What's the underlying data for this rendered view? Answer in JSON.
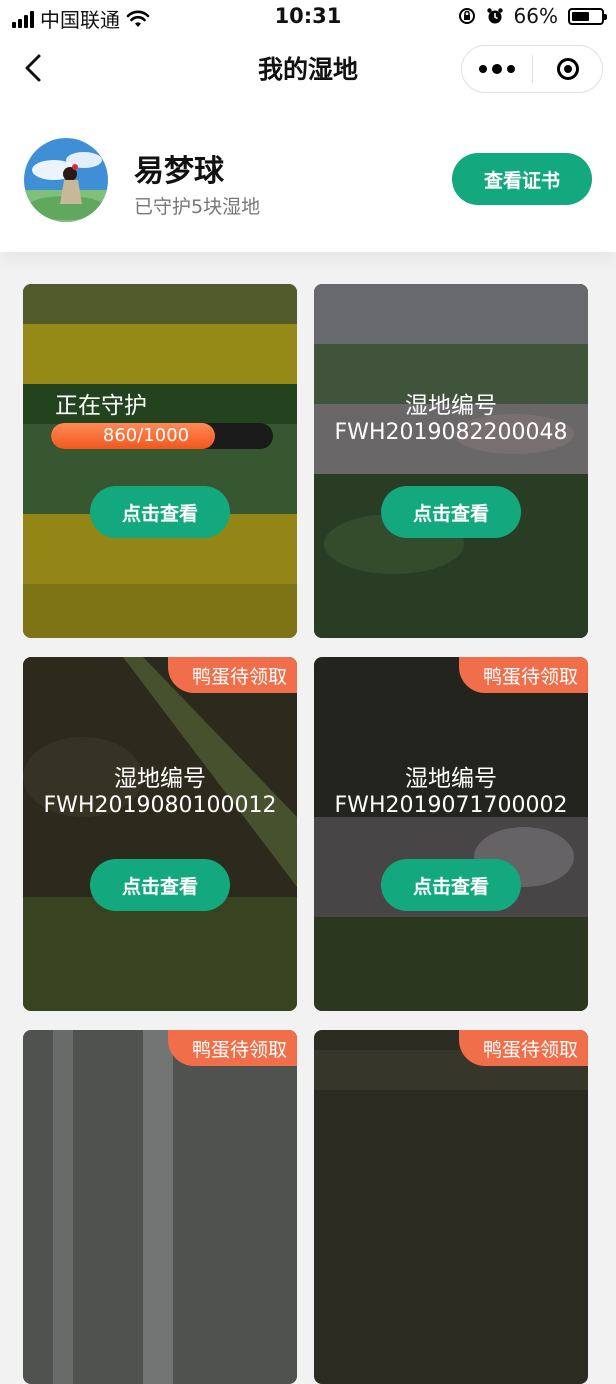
{
  "status_bar": {
    "carrier": "中国联通",
    "time": "10:31",
    "battery": "66%",
    "battery_level": 0.66
  },
  "nav": {
    "title": "我的湿地"
  },
  "profile": {
    "name": "易梦球",
    "subtitle": "已守护5块湿地",
    "cert_button": "查看证书"
  },
  "cards": [
    {
      "title": "正在守护",
      "progress_text": "860/1000",
      "progress_value": 0.86,
      "button": "点击查看",
      "bg_colors": [
        "#2f4a1c",
        "#c6b520",
        "#3a6a2a"
      ]
    },
    {
      "title": "湿地编号",
      "code": "FWH2019082200048",
      "button": "点击查看",
      "bg_colors": [
        "#8c8f94",
        "#4f6e4a",
        "#9a8b8f"
      ]
    },
    {
      "tag": "鸭蛋待领取",
      "title": "湿地编号",
      "code": "FWH2019080100012",
      "button": "点击查看",
      "bg_colors": [
        "#3b3a2a",
        "#5b6a3a",
        "#2c2a20"
      ]
    },
    {
      "tag": "鸭蛋待领取",
      "title": "湿地编号",
      "code": "FWH2019071700002",
      "button": "点击查看",
      "bg_colors": [
        "#2e2f2a",
        "#6d6a6e",
        "#3c4a2a"
      ]
    },
    {
      "tag": "鸭蛋待领取"
    },
    {
      "tag": "鸭蛋待领取"
    }
  ]
}
